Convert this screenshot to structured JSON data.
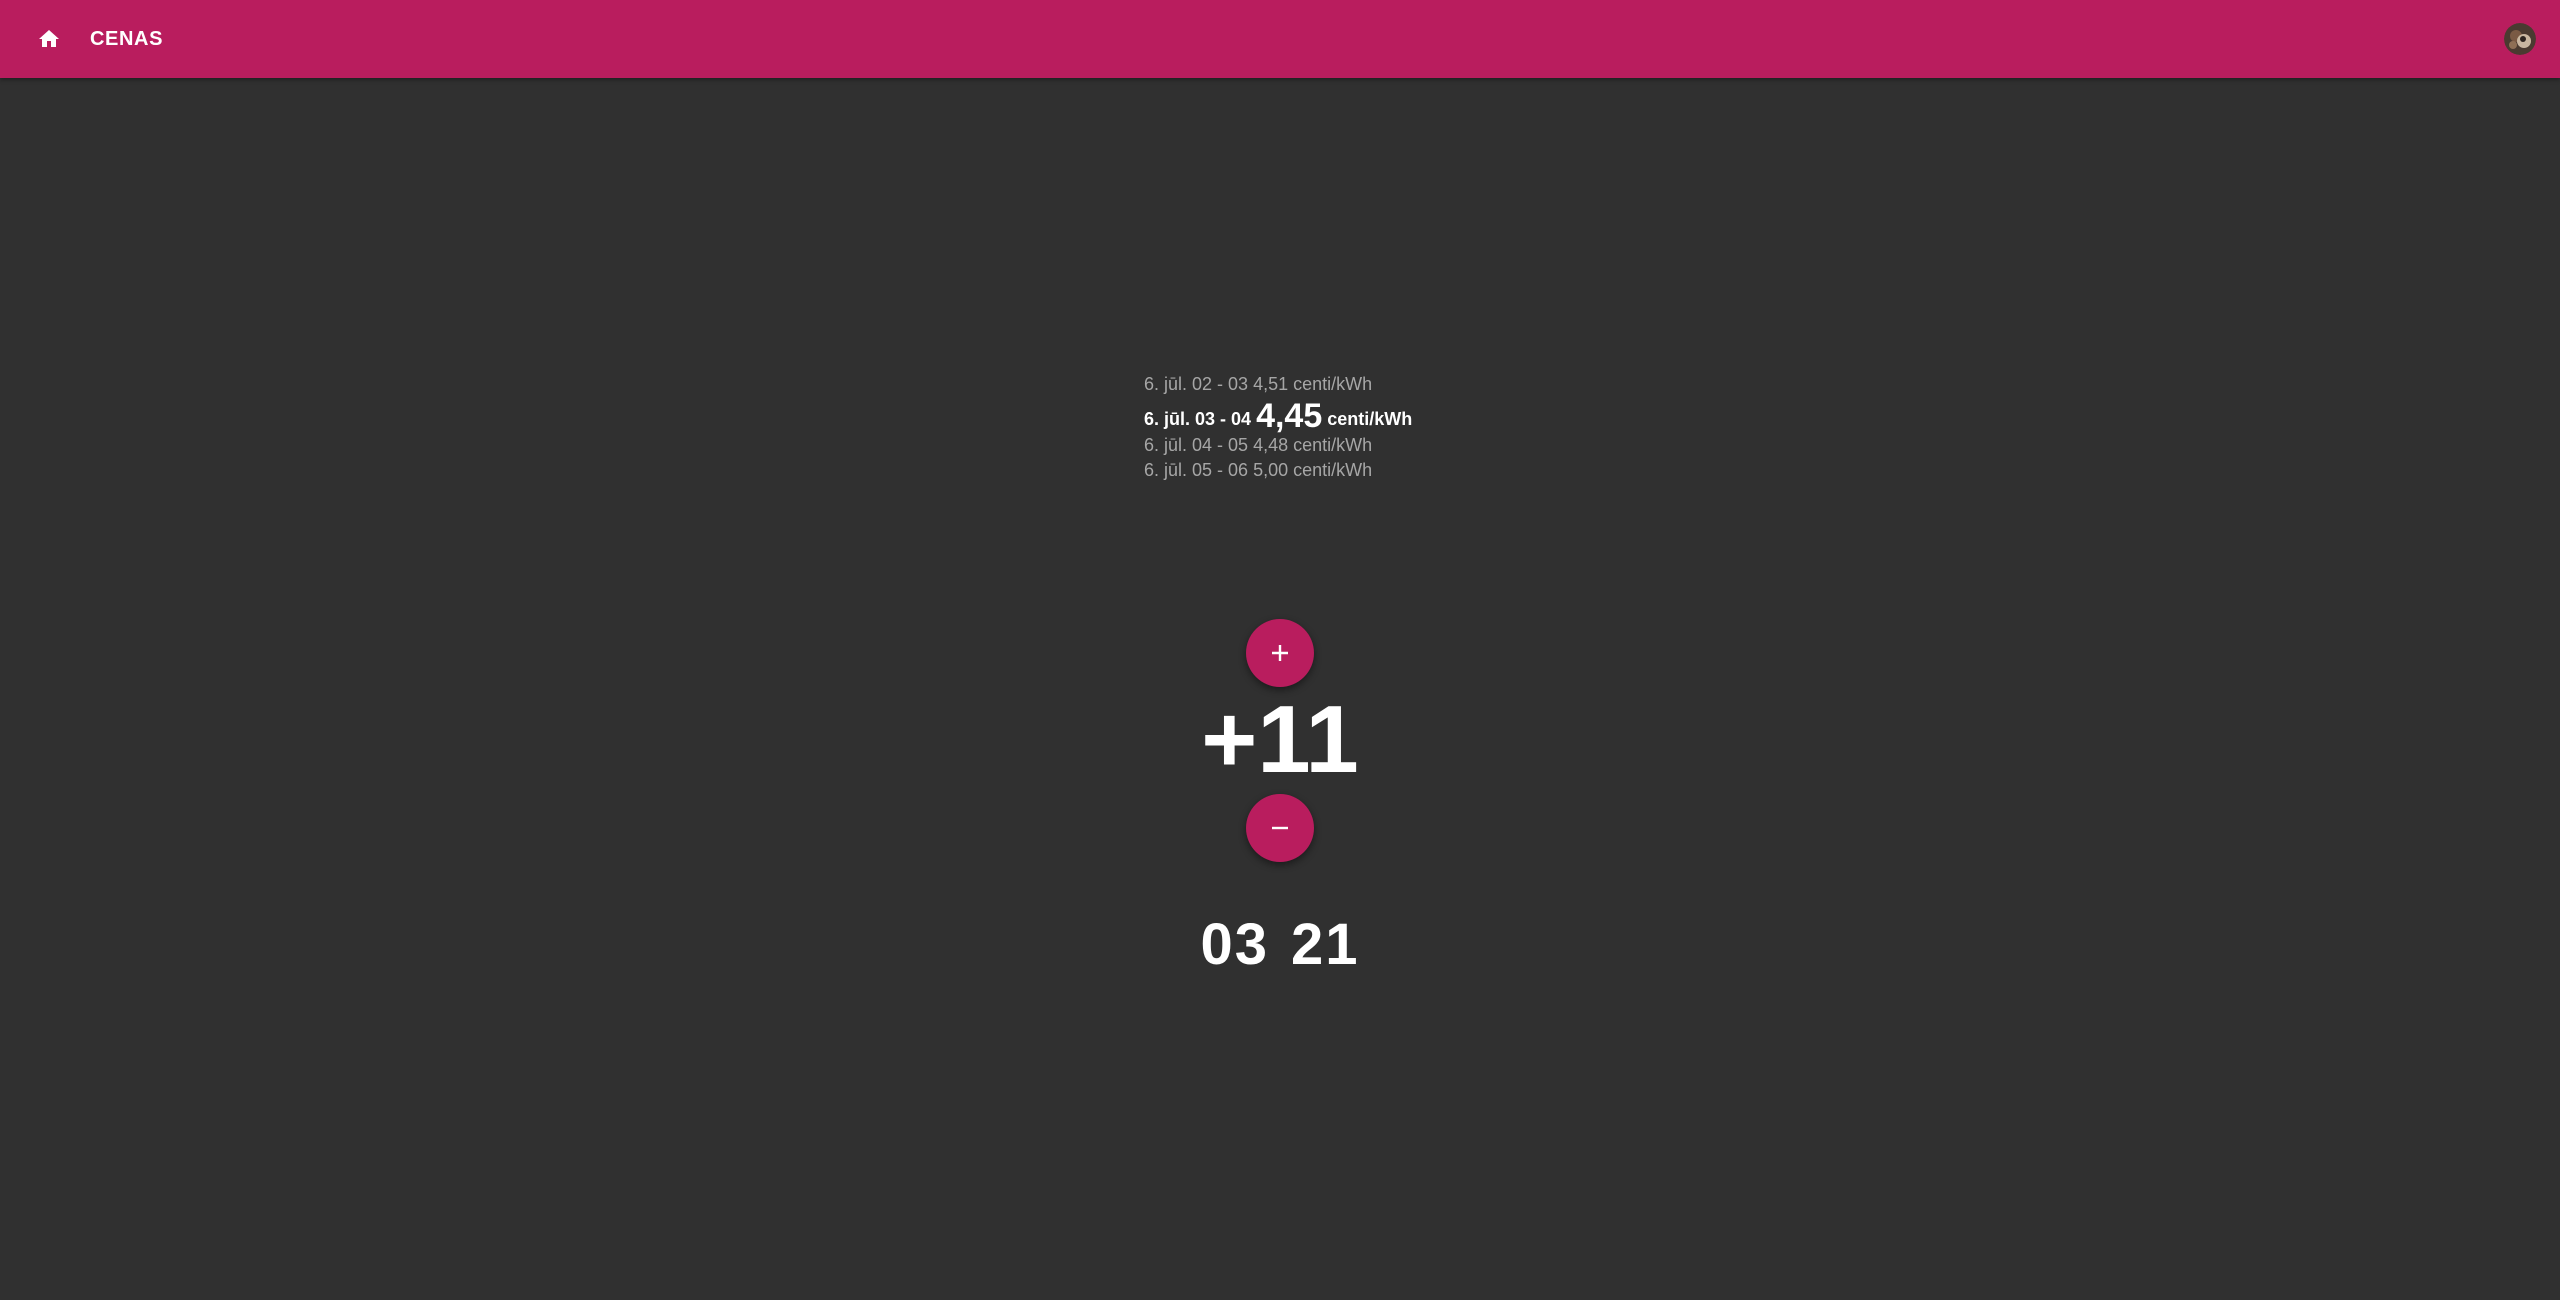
{
  "header": {
    "title": "CENAS",
    "home_icon": "home-icon",
    "avatar_icon": "user-avatar",
    "background_color": "#b91d5e"
  },
  "prices": {
    "previous": [
      "6. jūl. 02 - 03 4,51 centi/kWh"
    ],
    "current": {
      "label": "6. jūl. 03 - 04",
      "value": "4,45",
      "unit": "centi/kWh"
    },
    "next": [
      "6. jūl. 04 - 05 4,48 centi/kWh",
      "6. jūl. 05 - 06 5,00 centi/kWh"
    ]
  },
  "controls": {
    "increment_icon": "plus-icon",
    "decrement_icon": "minus-icon",
    "offset_value": "+11"
  },
  "clock": {
    "hours": "03",
    "minutes": "21"
  },
  "colors": {
    "accent": "#b91d5e",
    "background": "#303030",
    "muted_text": "#a6a6a6"
  }
}
